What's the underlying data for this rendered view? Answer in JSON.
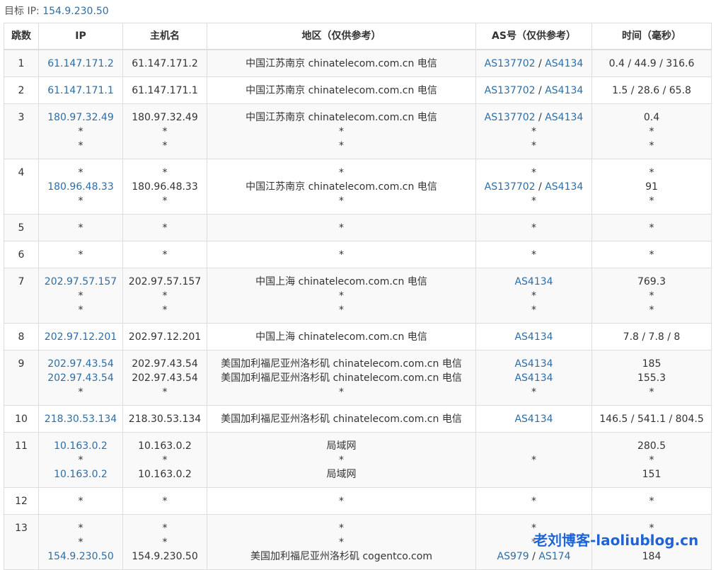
{
  "target": {
    "label": "目标 IP:",
    "ip": "154.9.230.50"
  },
  "headers": {
    "hop": "跳数",
    "ip": "IP",
    "host": "主机名",
    "region": "地区（仅供参考）",
    "as": "AS号（仅供参考）",
    "time": "时间（毫秒）"
  },
  "rows": [
    {
      "hop": "1",
      "ip": [
        "61.147.171.2"
      ],
      "host": [
        "61.147.171.2"
      ],
      "region": [
        "中国江苏南京 chinatelecom.com.cn 电信"
      ],
      "as": [
        [
          "AS137702",
          "AS4134"
        ]
      ],
      "time": [
        "0.4 / 44.9 / 316.6"
      ]
    },
    {
      "hop": "2",
      "ip": [
        "61.147.171.1"
      ],
      "host": [
        "61.147.171.1"
      ],
      "region": [
        "中国江苏南京 chinatelecom.com.cn 电信"
      ],
      "as": [
        [
          "AS137702",
          "AS4134"
        ]
      ],
      "time": [
        "1.5 / 28.6 / 65.8"
      ]
    },
    {
      "hop": "3",
      "ip": [
        "180.97.32.49",
        "*",
        "*"
      ],
      "host": [
        "180.97.32.49",
        "*",
        "*"
      ],
      "region": [
        "中国江苏南京 chinatelecom.com.cn 电信",
        "*",
        "*"
      ],
      "as": [
        [
          "AS137702",
          "AS4134"
        ],
        [
          "*"
        ],
        [
          "*"
        ]
      ],
      "time": [
        "0.4",
        "*",
        "*"
      ]
    },
    {
      "hop": "4",
      "ip": [
        "*",
        "180.96.48.33",
        "*"
      ],
      "host": [
        "*",
        "180.96.48.33",
        "*"
      ],
      "region": [
        "*",
        "中国江苏南京 chinatelecom.com.cn 电信",
        "*"
      ],
      "as": [
        [
          "*"
        ],
        [
          "AS137702",
          "AS4134"
        ],
        [
          "*"
        ]
      ],
      "time": [
        "*",
        "91",
        "*"
      ]
    },
    {
      "hop": "5",
      "ip": [
        "*"
      ],
      "host": [
        "*"
      ],
      "region": [
        "*"
      ],
      "as": [
        [
          "*"
        ]
      ],
      "time": [
        "*"
      ]
    },
    {
      "hop": "6",
      "ip": [
        "*"
      ],
      "host": [
        "*"
      ],
      "region": [
        "*"
      ],
      "as": [
        [
          "*"
        ]
      ],
      "time": [
        "*"
      ]
    },
    {
      "hop": "7",
      "ip": [
        "202.97.57.157",
        "*",
        "*"
      ],
      "host": [
        "202.97.57.157",
        "*",
        "*"
      ],
      "region": [
        "中国上海 chinatelecom.com.cn 电信",
        "*",
        "*"
      ],
      "as": [
        [
          "AS4134"
        ],
        [
          "*"
        ],
        [
          "*"
        ]
      ],
      "time": [
        "769.3",
        "*",
        "*"
      ]
    },
    {
      "hop": "8",
      "ip": [
        "202.97.12.201"
      ],
      "host": [
        "202.97.12.201"
      ],
      "region": [
        "中国上海 chinatelecom.com.cn 电信"
      ],
      "as": [
        [
          "AS4134"
        ]
      ],
      "time": [
        "7.8 / 7.8 / 8"
      ]
    },
    {
      "hop": "9",
      "ip": [
        "202.97.43.54",
        "202.97.43.54",
        "*"
      ],
      "host": [
        "202.97.43.54",
        "202.97.43.54",
        "*"
      ],
      "region": [
        "美国加利福尼亚州洛杉矶 chinatelecom.com.cn 电信",
        "美国加利福尼亚州洛杉矶 chinatelecom.com.cn 电信",
        "*"
      ],
      "as": [
        [
          "AS4134"
        ],
        [
          "AS4134"
        ],
        [
          "*"
        ]
      ],
      "time": [
        "185",
        "155.3",
        "*"
      ]
    },
    {
      "hop": "10",
      "ip": [
        "218.30.53.134"
      ],
      "host": [
        "218.30.53.134"
      ],
      "region": [
        "美国加利福尼亚州洛杉矶 chinatelecom.com.cn 电信"
      ],
      "as": [
        [
          "AS4134"
        ]
      ],
      "time": [
        "146.5 / 541.1 / 804.5"
      ]
    },
    {
      "hop": "11",
      "ip": [
        "10.163.0.2",
        "*",
        "10.163.0.2"
      ],
      "host": [
        "10.163.0.2",
        "*",
        "10.163.0.2"
      ],
      "region": [
        "局域网",
        "*",
        "局域网"
      ],
      "as": [
        [
          ""
        ],
        [
          "*"
        ],
        [
          ""
        ]
      ],
      "time": [
        "280.5",
        "*",
        "151"
      ]
    },
    {
      "hop": "12",
      "ip": [
        "*"
      ],
      "host": [
        "*"
      ],
      "region": [
        "*"
      ],
      "as": [
        [
          "*"
        ]
      ],
      "time": [
        "*"
      ]
    },
    {
      "hop": "13",
      "ip": [
        "*",
        "*",
        "154.9.230.50"
      ],
      "host": [
        "*",
        "*",
        "154.9.230.50"
      ],
      "region": [
        "*",
        "*",
        "美国加利福尼亚州洛杉矶 cogentco.com"
      ],
      "as": [
        [
          "*"
        ],
        [
          "*"
        ],
        [
          "AS979",
          "AS174"
        ]
      ],
      "time": [
        "*",
        "*",
        "184"
      ]
    }
  ],
  "watermark": "老刘博客-laoliublog.cn",
  "colors": {
    "link": "#2f6da3",
    "text": "#333333",
    "border": "#dddddd",
    "stripe": "#f9f9f9",
    "watermark": "#1f63d6"
  }
}
